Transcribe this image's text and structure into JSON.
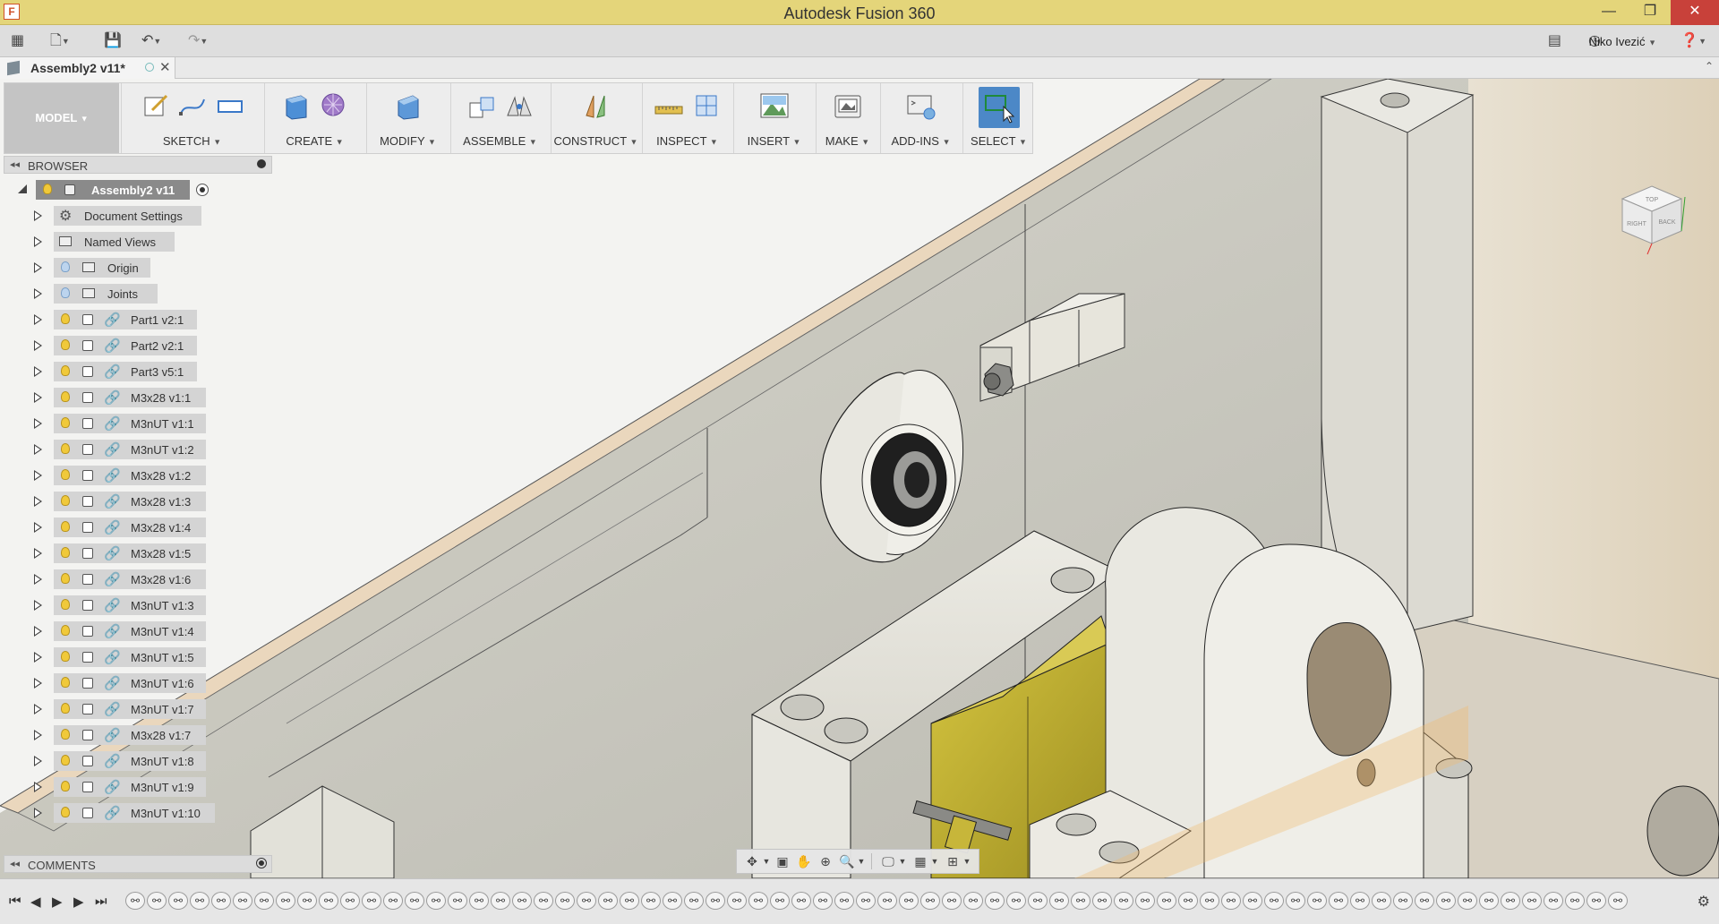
{
  "window": {
    "title": "Autodesk Fusion 360",
    "logo": "F",
    "minimize_icon": "—",
    "maximize_icon": "❐",
    "close_icon": "✕"
  },
  "quick_access": {
    "user_name": "Niko Ivezić"
  },
  "document_tab": {
    "label": "Assembly2 v11*"
  },
  "toolbar": {
    "workspace": "MODEL",
    "groups": [
      {
        "label": "SKETCH"
      },
      {
        "label": "CREATE"
      },
      {
        "label": "MODIFY"
      },
      {
        "label": "ASSEMBLE"
      },
      {
        "label": "CONSTRUCT"
      },
      {
        "label": "INSPECT"
      },
      {
        "label": "INSERT"
      },
      {
        "label": "MAKE"
      },
      {
        "label": "ADD-INS"
      },
      {
        "label": "SELECT"
      }
    ]
  },
  "browser": {
    "title": "BROWSER",
    "root": "Assembly2 v11",
    "items": [
      "Document Settings",
      "Named Views",
      "Origin",
      "Joints",
      "Part1 v2:1",
      "Part2 v2:1",
      "Part3 v5:1",
      "M3x28 v1:1",
      "M3nUT v1:1",
      "M3nUT v1:2",
      "M3x28 v1:2",
      "M3x28 v1:3",
      "M3x28 v1:4",
      "M3x28 v1:5",
      "M3x28 v1:6",
      "M3nUT v1:3",
      "M3nUT v1:4",
      "M3nUT v1:5",
      "M3nUT v1:6",
      "M3nUT v1:7",
      "M3x28 v1:7",
      "M3nUT v1:8",
      "M3nUT v1:9",
      "M3nUT v1:10"
    ]
  },
  "comments": {
    "title": "COMMENTS"
  },
  "viewcube": {
    "top": "TOP",
    "right": "RIGHT",
    "back": "BACK"
  },
  "colors": {
    "title_bar": "#e4d57a",
    "selection_blue": "#4c88c7",
    "part_yellow": "#c9b73a",
    "part_body": "#e9e6dc"
  }
}
